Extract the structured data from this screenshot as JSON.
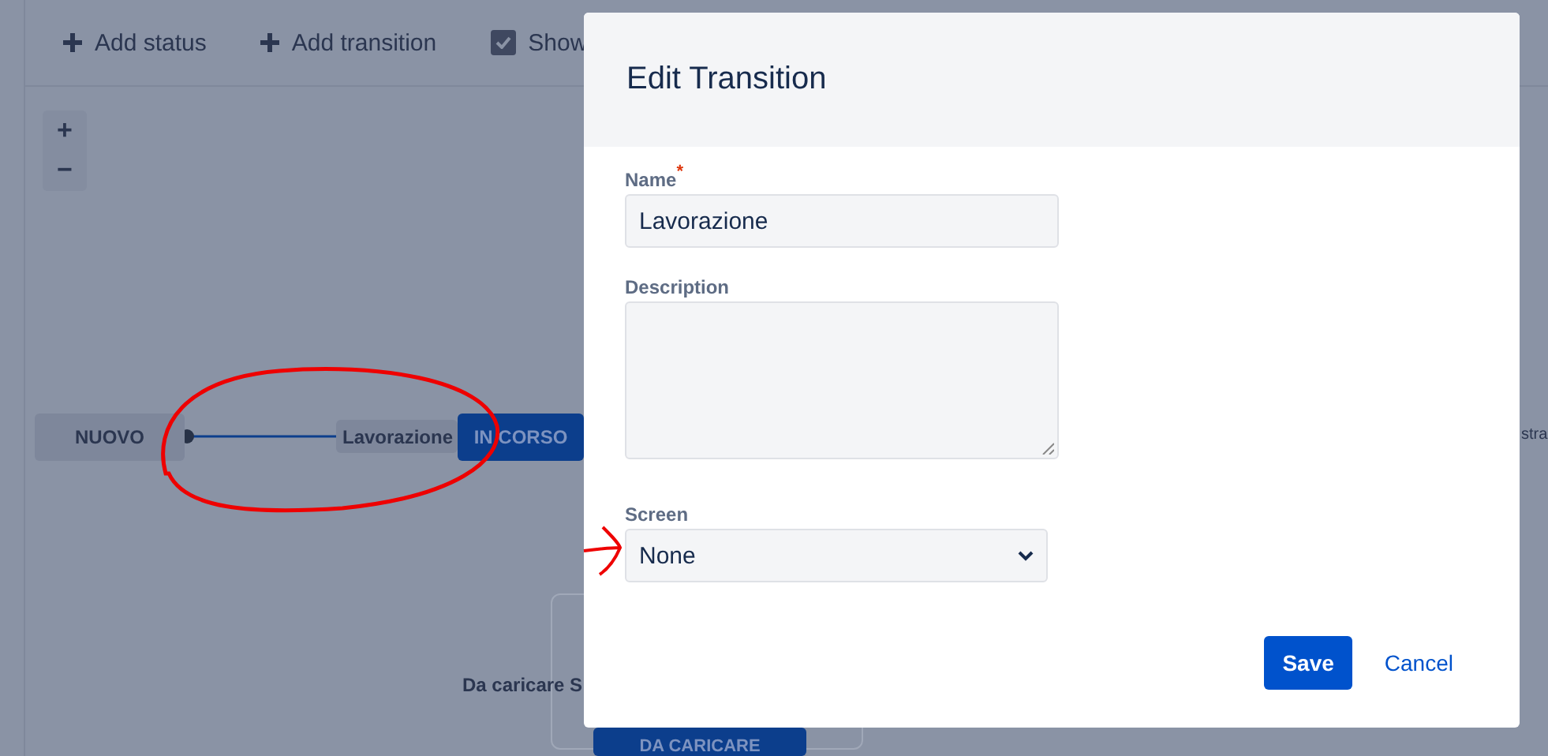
{
  "toolbar": [
    {
      "kind": "add",
      "label": "Add status"
    },
    {
      "kind": "add",
      "label": "Add transition"
    },
    {
      "kind": "checkbox",
      "label": "Show",
      "checked": true
    }
  ],
  "zoom": [
    "+",
    "−"
  ],
  "diagram": {
    "statuses": [
      {
        "label": "NUOVO",
        "kind": "todo"
      },
      {
        "label": "IN CORSO",
        "kind": "progress"
      },
      {
        "label": "DA CARICARE",
        "kind": "progress"
      }
    ],
    "transition": {
      "label": "Lavorazione"
    },
    "loop_label": "Da caricare S",
    "edge_label": "stra"
  },
  "modal": {
    "title": "Edit Transition",
    "fields": [
      {
        "kind": "text",
        "label": "Name",
        "required_mark": "*",
        "value": "Lavorazione"
      },
      {
        "kind": "textarea",
        "label": "Description"
      },
      {
        "kind": "select",
        "label": "Screen",
        "value": "None"
      }
    ],
    "buttons": [
      {
        "kind": "primary",
        "label": "Save"
      },
      {
        "kind": "link",
        "label": "Cancel"
      }
    ]
  }
}
